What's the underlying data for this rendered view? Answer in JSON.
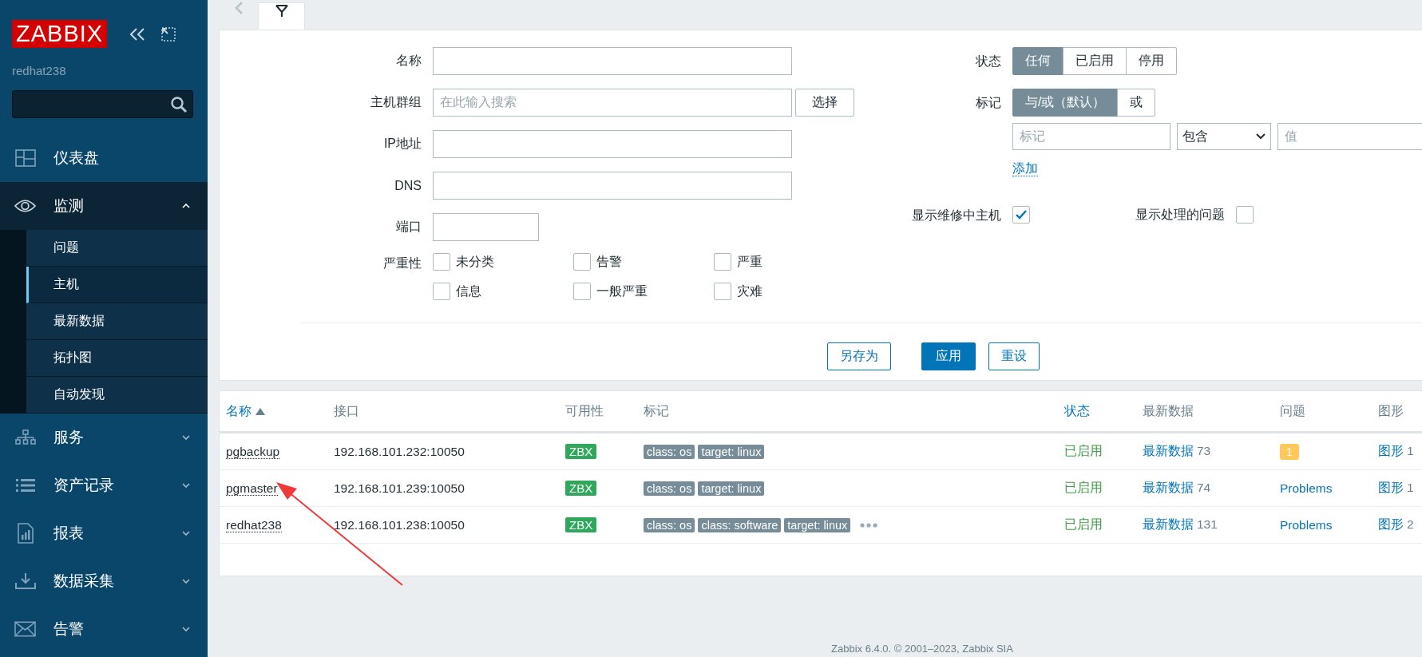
{
  "sidebar": {
    "logo": "ZABBIX",
    "server_name": "redhat238",
    "menu": [
      {
        "kind": "link",
        "label": "仪表盘"
      },
      {
        "kind": "group",
        "label": "监测",
        "expanded": true,
        "children": [
          {
            "label": "问题",
            "selected": false
          },
          {
            "label": "主机",
            "selected": true
          },
          {
            "label": "最新数据",
            "selected": false
          },
          {
            "label": "拓扑图",
            "selected": false
          },
          {
            "label": "自动发现",
            "selected": false
          }
        ]
      },
      {
        "kind": "group",
        "label": "服务",
        "expanded": false
      },
      {
        "kind": "group",
        "label": "资产记录",
        "expanded": false
      },
      {
        "kind": "group",
        "label": "报表",
        "expanded": false
      },
      {
        "kind": "group",
        "label": "数据采集",
        "expanded": false
      },
      {
        "kind": "group",
        "label": "告警",
        "expanded": false
      }
    ]
  },
  "filter": {
    "fields": [
      {
        "label": "名称",
        "kind": "text"
      },
      {
        "label": "主机群组",
        "kind": "multiselect",
        "placeholder": "在此输入搜索",
        "button": "选择"
      },
      {
        "label": "IP地址",
        "kind": "text"
      },
      {
        "label": "DNS",
        "kind": "text"
      },
      {
        "label": "端口",
        "kind": "short"
      }
    ],
    "severity": {
      "label": "严重性",
      "options": [
        {
          "label": "未分类",
          "checked": false
        },
        {
          "label": "告警",
          "checked": false
        },
        {
          "label": "严重",
          "checked": false
        },
        {
          "label": "信息",
          "checked": false
        },
        {
          "label": "一般严重",
          "checked": false
        },
        {
          "label": "灾难",
          "checked": false
        }
      ]
    },
    "status": {
      "label": "状态",
      "options": [
        {
          "label": "任何",
          "selected": true
        },
        {
          "label": "已启用",
          "selected": false
        },
        {
          "label": "停用",
          "selected": false
        }
      ]
    },
    "tags": {
      "label": "标记",
      "options": [
        {
          "label": "与/或（默认）",
          "selected": true
        },
        {
          "label": "或",
          "selected": false
        }
      ],
      "tag_placeholder": "标记",
      "operator": "包含",
      "value_placeholder": "值",
      "add_link": "添加"
    },
    "show_maintenance": {
      "label": "显示维修中主机",
      "checked": true
    },
    "show_suppressed": {
      "label": "显示处理的问题",
      "checked": false
    },
    "buttons": [
      {
        "label": "另存为",
        "kind": "secondary"
      },
      {
        "label": "应用",
        "kind": "primary"
      },
      {
        "label": "重设",
        "kind": "secondary"
      }
    ]
  },
  "table": {
    "columns": [
      {
        "label": "名称",
        "sortable": true,
        "sorted": true
      },
      {
        "label": "接口",
        "sortable": false,
        "sorted": false
      },
      {
        "label": "可用性",
        "sortable": false,
        "sorted": false
      },
      {
        "label": "标记",
        "sortable": false,
        "sorted": false
      },
      {
        "label": "状态",
        "sortable": true,
        "sorted": false
      },
      {
        "label": "最新数据",
        "sortable": false,
        "sorted": false
      },
      {
        "label": "问题",
        "sortable": false,
        "sorted": false
      },
      {
        "label": "图形",
        "sortable": false,
        "sorted": false
      }
    ],
    "rows": [
      {
        "name": "pgbackup",
        "interface": "192.168.101.232:10050",
        "availability": "ZBX",
        "tags": [
          "class: os",
          "target: linux"
        ],
        "more_tags": false,
        "status": "已启用",
        "latest_data": {
          "label": "最新数据",
          "count": "73"
        },
        "problems": {
          "kind": "badge",
          "label": "1"
        },
        "graphs": {
          "label": "图形",
          "count": "1"
        }
      },
      {
        "name": "pgmaster",
        "interface": "192.168.101.239:10050",
        "availability": "ZBX",
        "tags": [
          "class: os",
          "target: linux"
        ],
        "more_tags": false,
        "status": "已启用",
        "latest_data": {
          "label": "最新数据",
          "count": "74"
        },
        "problems": {
          "kind": "link",
          "label": "Problems"
        },
        "graphs": {
          "label": "图形",
          "count": "1"
        }
      },
      {
        "name": "redhat238",
        "interface": "192.168.101.238:10050",
        "availability": "ZBX",
        "tags": [
          "class: os",
          "class: software",
          "target: linux"
        ],
        "more_tags": true,
        "status": "已启用",
        "latest_data": {
          "label": "最新数据",
          "count": "131"
        },
        "problems": {
          "kind": "link",
          "label": "Problems"
        },
        "graphs": {
          "label": "图形",
          "count": "2"
        }
      }
    ]
  },
  "footer": "Zabbix 6.4.0. © 2001–2023, Zabbix SIA"
}
